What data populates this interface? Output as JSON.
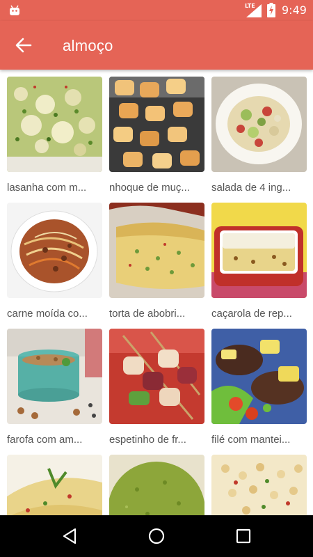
{
  "status_bar": {
    "time": "9:49",
    "network": "LTE",
    "icons": [
      "android-icon",
      "signal-icon",
      "battery-charging-icon"
    ]
  },
  "app_bar": {
    "title": "almoço",
    "back_icon": "arrow-back-icon"
  },
  "recipes": [
    {
      "title": "lasanha com m..."
    },
    {
      "title": "nhoque de muç..."
    },
    {
      "title": "salada de 4 ing..."
    },
    {
      "title": "carne moída co..."
    },
    {
      "title": "torta de abobri..."
    },
    {
      "title": "caçarola de rep..."
    },
    {
      "title": "farofa com am..."
    },
    {
      "title": "espetinho de fr..."
    },
    {
      "title": "filé com mantei..."
    },
    {
      "title": ""
    },
    {
      "title": ""
    },
    {
      "title": ""
    }
  ],
  "nav_bar": {
    "icons": [
      "back-triangle-icon",
      "home-circle-icon",
      "recents-square-icon"
    ]
  },
  "colors": {
    "primary": "#e56456",
    "nav_background": "#000000",
    "label_text": "#555555"
  }
}
